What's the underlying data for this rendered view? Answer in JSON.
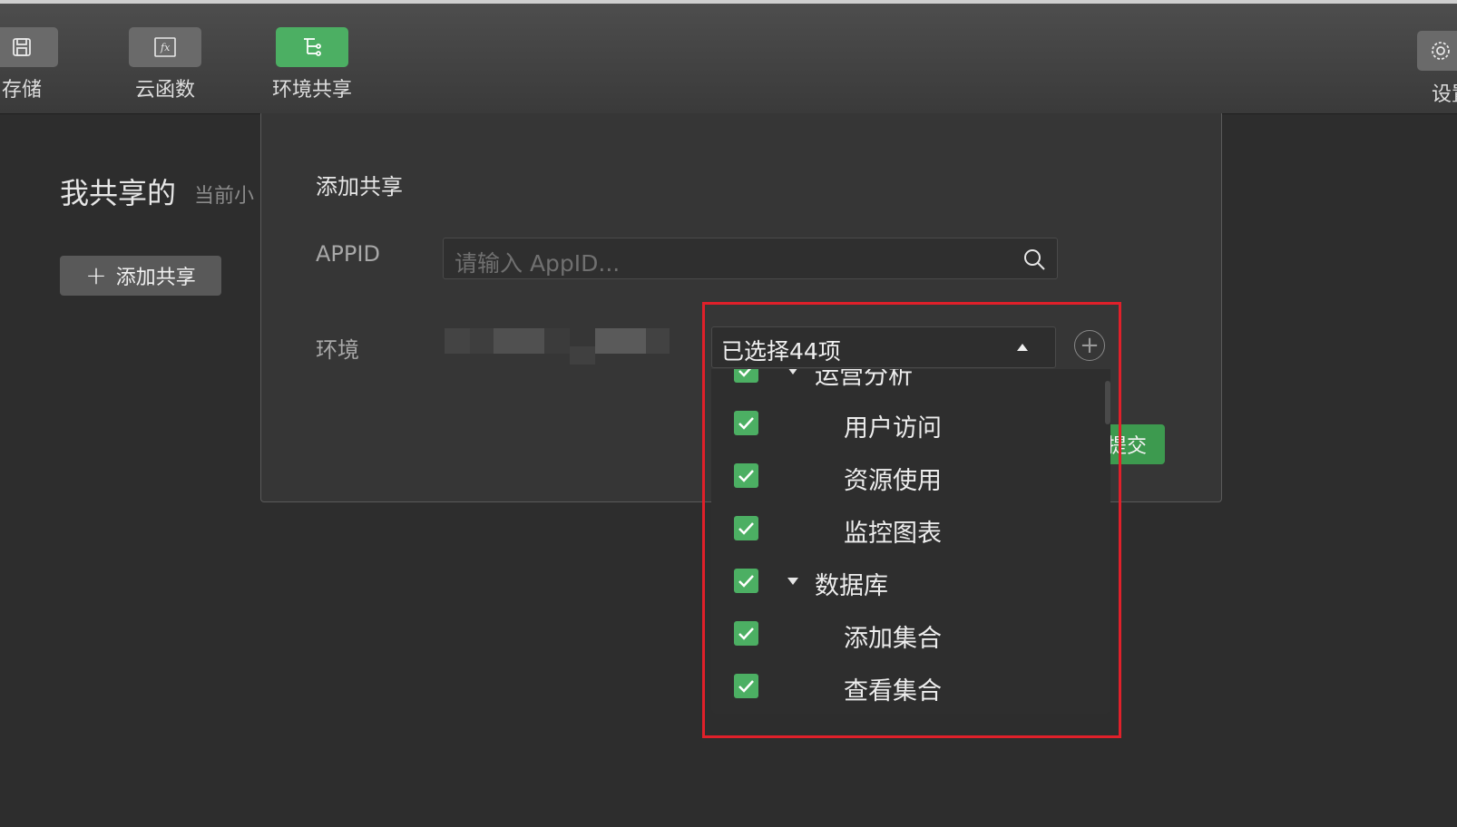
{
  "toolbar": {
    "items": [
      {
        "label": "存储",
        "icon": "save-icon",
        "active": false
      },
      {
        "label": "云函数",
        "icon": "function-fx-icon",
        "active": false
      },
      {
        "label": "环境共享",
        "icon": "tree-share-icon",
        "active": true
      }
    ],
    "settings": {
      "label": "设置",
      "icon": "gear-icon"
    }
  },
  "left": {
    "title": "我共享的",
    "subtitle": "当前小",
    "add_button": "添加共享"
  },
  "modal": {
    "title": "添加共享",
    "appid_label": "APPID",
    "appid_placeholder": "请输入 AppID...",
    "env_label": "环境",
    "select_value": "已选择44项",
    "submit_label": "提交"
  },
  "dropdown": {
    "options": [
      {
        "label": "运营分析",
        "level": "parent",
        "checked": true
      },
      {
        "label": "用户访问",
        "level": "child",
        "checked": true
      },
      {
        "label": "资源使用",
        "level": "child",
        "checked": true
      },
      {
        "label": "监控图表",
        "level": "child",
        "checked": true
      },
      {
        "label": "数据库",
        "level": "parent",
        "checked": true
      },
      {
        "label": "添加集合",
        "level": "child",
        "checked": true
      },
      {
        "label": "查看集合",
        "level": "child",
        "checked": true
      }
    ]
  },
  "colors": {
    "accent_green": "#4caf63",
    "highlight_red": "#e0202a",
    "background": "#2d2d2d"
  }
}
